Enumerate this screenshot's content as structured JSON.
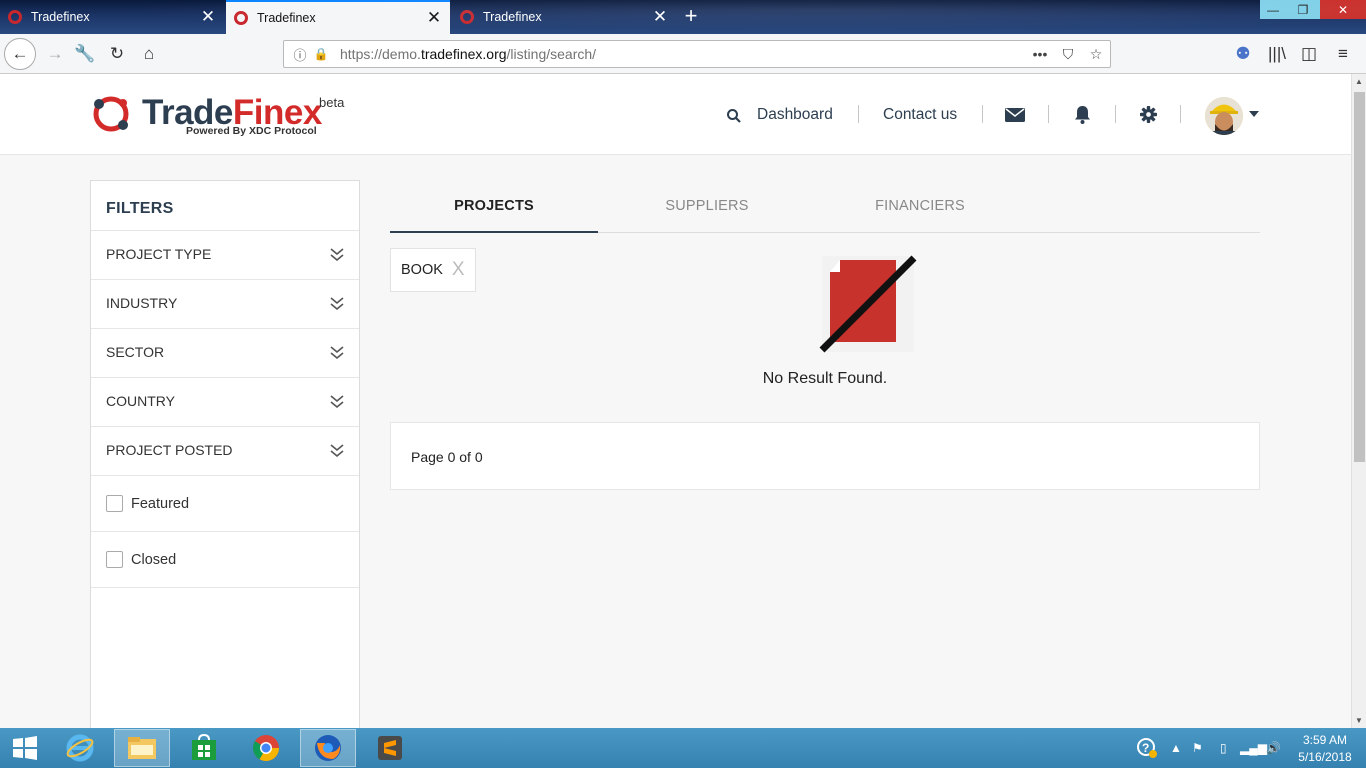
{
  "browser": {
    "tabs": [
      {
        "title": "Tradefinex",
        "active": false
      },
      {
        "title": "Tradefinex",
        "active": true
      },
      {
        "title": "Tradefinex",
        "active": false
      }
    ],
    "url_prefix": "https://demo.",
    "url_domain": "tradefinex.org",
    "url_path": "/listing/search/"
  },
  "header": {
    "brand_part1": "Trade",
    "brand_part2": "Finex",
    "beta": "beta",
    "tagline": "Powered By XDC Protocol",
    "nav": {
      "dashboard": "Dashboard",
      "contact": "Contact us"
    }
  },
  "filters": {
    "title": "FILTERS",
    "dropdowns": [
      "PROJECT TYPE",
      "INDUSTRY",
      "SECTOR",
      "COUNTRY",
      "PROJECT POSTED"
    ],
    "checkboxes": [
      {
        "label": "Featured",
        "checked": false
      },
      {
        "label": "Closed",
        "checked": false
      }
    ]
  },
  "main": {
    "tabs": [
      {
        "label": "PROJECTS",
        "active": true
      },
      {
        "label": "SUPPLIERS",
        "active": false
      },
      {
        "label": "FINANCIERS",
        "active": false
      }
    ],
    "chip": {
      "label": "BOOK",
      "remove": "X"
    },
    "no_result": "No Result Found.",
    "pagination": "Page 0 of 0"
  },
  "taskbar": {
    "time": "3:59 AM",
    "date": "5/16/2018"
  },
  "colors": {
    "brand_dark": "#2c3e50",
    "brand_red": "#d32a2a",
    "taskbar": "#3582b1"
  }
}
